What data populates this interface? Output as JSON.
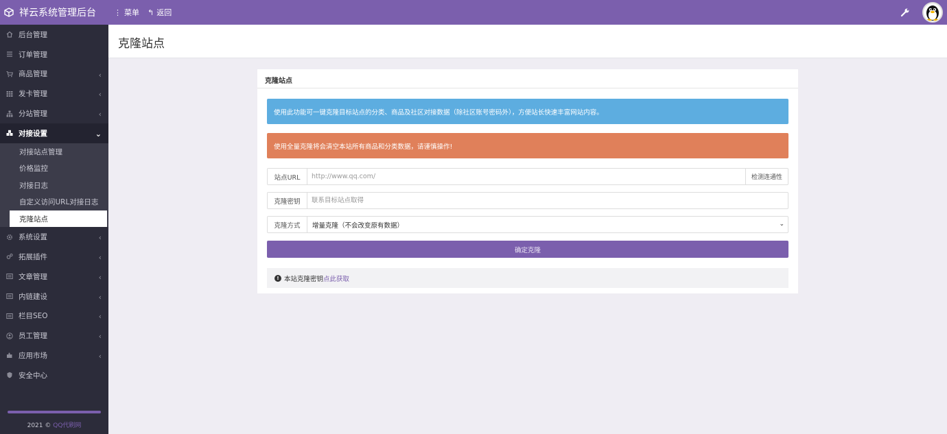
{
  "app": {
    "title": "祥云系统管理后台"
  },
  "topbar": {
    "menu_label": "菜单",
    "back_label": "返回"
  },
  "sidebar": {
    "items": [
      {
        "label": "后台管理",
        "icon": "home-icon"
      },
      {
        "label": "订单管理",
        "icon": "list-icon"
      },
      {
        "label": "商品管理",
        "icon": "cart-icon"
      },
      {
        "label": "发卡管理",
        "icon": "grid-icon"
      },
      {
        "label": "分站管理",
        "icon": "sitemap-icon"
      },
      {
        "label": "对接设置",
        "icon": "cubes-icon"
      },
      {
        "label": "系统设置",
        "icon": "gear-icon"
      },
      {
        "label": "拓展插件",
        "icon": "gears-icon"
      },
      {
        "label": "文章管理",
        "icon": "article-icon"
      },
      {
        "label": "内链建设",
        "icon": "link-icon"
      },
      {
        "label": "栏目SEO",
        "icon": "seo-icon"
      },
      {
        "label": "员工管理",
        "icon": "user-icon"
      },
      {
        "label": "应用市场",
        "icon": "puzzle-icon"
      },
      {
        "label": "安全中心",
        "icon": "shield-icon"
      }
    ],
    "submenu": [
      "对接站点管理",
      "价格监控",
      "对接日志",
      "自定义访问URL对接日志",
      "克隆站点"
    ],
    "footer_year": "2021 ©",
    "footer_link": "QQ代刷网"
  },
  "page": {
    "title": "克隆站点",
    "panel_title": "克隆站点",
    "alert_info": "使用此功能可一键克隆目标站点的分类、商品及社区对接数据（除社区账号密码外），方便站长快速丰富网站内容。",
    "alert_warn": "使用全量克隆将会清空本站所有商品和分类数据，请谨慎操作!",
    "form": {
      "url_label": "站点URL",
      "url_placeholder": "http://www.qq.com/",
      "check_btn": "检测连通性",
      "key_label": "克隆密钥",
      "key_placeholder": "联系目标站点取得",
      "mode_label": "克隆方式",
      "mode_value": "增量克隆（不会改变原有数据）",
      "submit": "确定克隆"
    },
    "note_text": "本站克隆密钥",
    "note_link": "点此获取"
  }
}
